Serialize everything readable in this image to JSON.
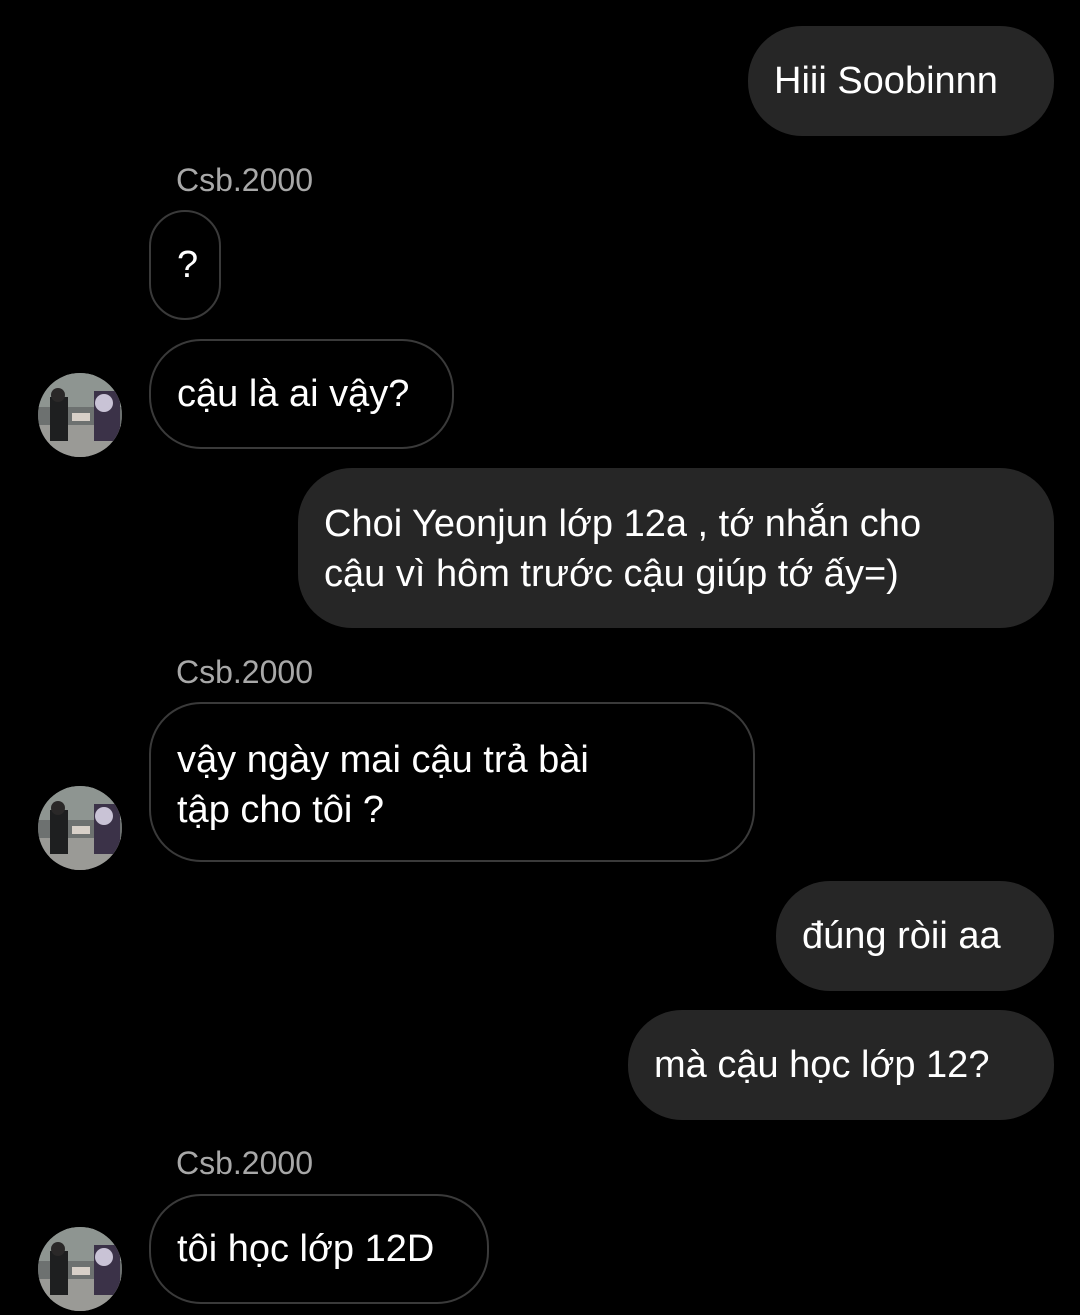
{
  "conversation": {
    "messages": [
      {
        "direction": "outgoing",
        "text": "Hiii Soobinnn"
      },
      {
        "direction": "incoming",
        "sender": "Csb.2000",
        "text": "?"
      },
      {
        "direction": "incoming",
        "text": "cậu là ai vậy?"
      },
      {
        "direction": "outgoing",
        "lines": [
          "Choi Yeonjun lớp 12a , tớ nhắn cho",
          "cậu vì hôm trước cậu giúp tớ ấy=)"
        ]
      },
      {
        "direction": "incoming",
        "sender": "Csb.2000",
        "lines": [
          "vậy ngày mai cậu trả bài",
          "tập cho tôi ?"
        ]
      },
      {
        "direction": "outgoing",
        "text": "đúng ròii aa"
      },
      {
        "direction": "outgoing",
        "text": "mà cậu học lớp 12?"
      },
      {
        "direction": "incoming",
        "sender": "Csb.2000",
        "text": "tôi học lớp 12D"
      }
    ]
  },
  "colors": {
    "background": "#000000",
    "outgoing_bubble": "#262626",
    "incoming_border": "#3a3a3a",
    "sender_text": "#a8a8a8",
    "message_text": "#ffffff"
  },
  "icons": {
    "avatar": "contact-avatar-photo"
  }
}
